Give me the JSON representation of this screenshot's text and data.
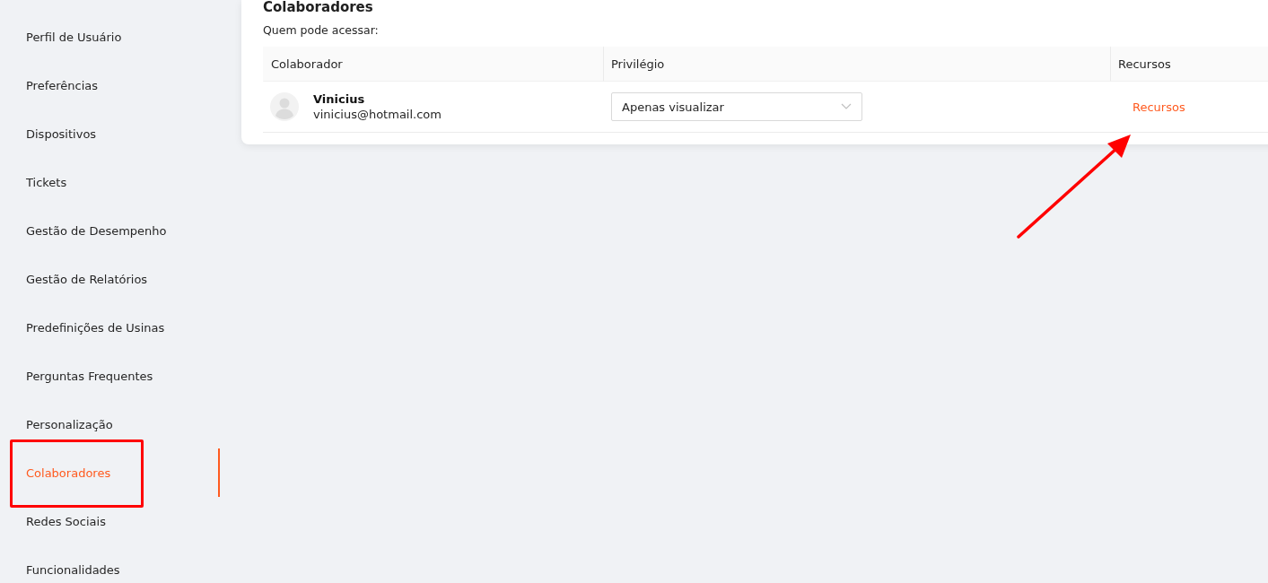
{
  "sidebar": {
    "items": [
      {
        "label": "Perfil de Usuário",
        "selected": false
      },
      {
        "label": "Preferências",
        "selected": false
      },
      {
        "label": "Dispositivos",
        "selected": false
      },
      {
        "label": "Tickets",
        "selected": false
      },
      {
        "label": "Gestão de Desempenho",
        "selected": false
      },
      {
        "label": "Gestão de Relatórios",
        "selected": false
      },
      {
        "label": "Predefinições de Usinas",
        "selected": false
      },
      {
        "label": "Perguntas Frequentes",
        "selected": false
      },
      {
        "label": "Personalização",
        "selected": false
      },
      {
        "label": "Colaboradores",
        "selected": true
      },
      {
        "label": "Redes Sociais",
        "selected": false
      },
      {
        "label": "Funcionalidades",
        "selected": false
      }
    ]
  },
  "card": {
    "title": "Colaboradores",
    "subtitle": "Quem pode acessar:",
    "table": {
      "columns": [
        "Colaborador",
        "Privilégio",
        "Recursos"
      ],
      "rows": [
        {
          "name": "Vinicius",
          "email": "vinicius@hotmail.com",
          "privilege": "Apenas visualizar",
          "resources_link": "Recursos"
        }
      ]
    }
  }
}
